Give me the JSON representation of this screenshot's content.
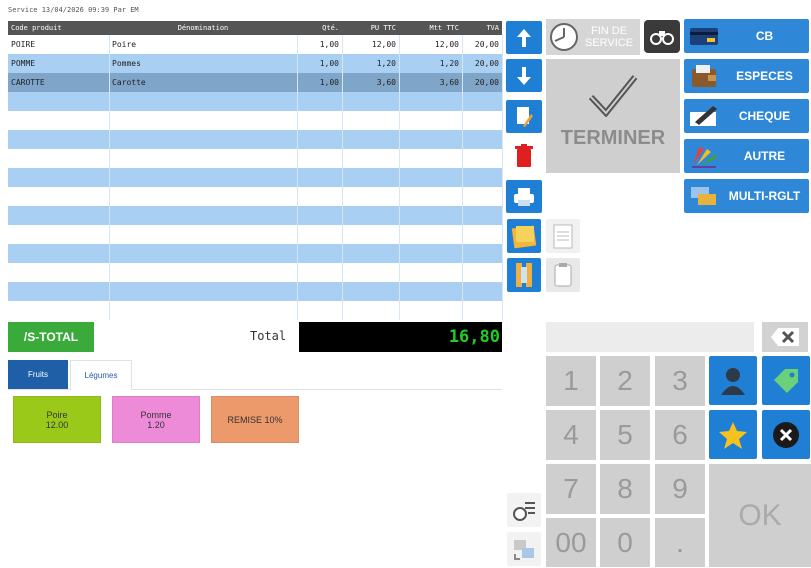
{
  "header": {
    "service_line": "Service 13/04/2026 09:39  Par EM"
  },
  "grid": {
    "columns": [
      "Code produit",
      "Dénomination",
      "Qté.",
      "PU TTC",
      "Mtt TTC",
      "TVA"
    ],
    "rows": [
      {
        "code": "POIRE",
        "name": "Poire",
        "qty": "1,00",
        "pu": "12,00",
        "mtt": "12,00",
        "tva": "20,00"
      },
      {
        "code": "POMME",
        "name": "Pommes",
        "qty": "1,00",
        "pu": "1,20",
        "mtt": "1,20",
        "tva": "20,00"
      },
      {
        "code": "CAROTTE",
        "name": "Carotte",
        "qty": "1,00",
        "pu": "3,60",
        "mtt": "3,60",
        "tva": "20,00"
      }
    ]
  },
  "actions": {
    "fin_de_service": "FIN DE SERVICE",
    "terminer": "TERMINER"
  },
  "payments": [
    {
      "label": "CB",
      "icon": "credit-card-icon"
    },
    {
      "label": "ESPECES",
      "icon": "wallet-icon"
    },
    {
      "label": "CHEQUE",
      "icon": "cheque-pen-icon"
    },
    {
      "label": "AUTRE",
      "icon": "color-swatch-icon"
    },
    {
      "label": "MULTI-RGLT",
      "icon": "multi-payment-icon"
    }
  ],
  "totals": {
    "subtotal_label": "/S-TOTAL",
    "total_label": "Total",
    "total_value": "16,80"
  },
  "tabs": [
    {
      "label": "Fruits",
      "active": true
    },
    {
      "label": "Légumes",
      "active": false
    }
  ],
  "products": [
    {
      "name": "Poire",
      "price": "12.00",
      "color": "#9bc91a"
    },
    {
      "name": "Pomme",
      "price": "1.20",
      "color": "#ee8bd8"
    },
    {
      "name": "REMISE 10%",
      "price": "",
      "color": "#ec9a6c"
    }
  ],
  "keypad": {
    "digits": [
      "1",
      "2",
      "3",
      "4",
      "5",
      "6",
      "7",
      "8",
      "9",
      "00",
      "0",
      "."
    ],
    "ok": "OK"
  },
  "colors": {
    "accent": "#1f7fd4",
    "row_stripe": "#a9cff3",
    "selected_row": "#7fa6c9",
    "header": "#555555",
    "total_bg": "#000000",
    "total_fg": "#22cc22"
  }
}
